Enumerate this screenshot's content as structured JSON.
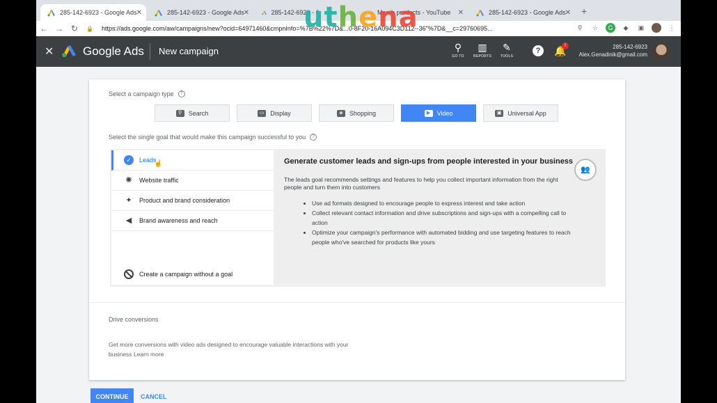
{
  "browser": {
    "tabs": [
      {
        "title": "285-142-6923 - Google Ads",
        "active": true
      },
      {
        "title": "285-142-6923 - Google Ads",
        "active": false
      },
      {
        "title": "285-142-6923 - Google Ads",
        "active": false
      },
      {
        "title": "Merch products - YouTube",
        "active": false
      },
      {
        "title": "285-142-6923 - Google Ads",
        "active": false
      }
    ],
    "url": "https://ads.google.com/aw/campaigns/new?ocid=64971460&cmpnInfo=%7B%22%7D&...0-8F20-16A094C3D112--36\"%7D&__c=29760695..."
  },
  "watermark": {
    "letters": [
      "u",
      "t",
      "h",
      "e",
      "n",
      "a"
    ]
  },
  "header": {
    "brand": "Google Ads",
    "page_title": "New campaign",
    "tools": [
      {
        "label": "GO TO",
        "icon": "search-icon"
      },
      {
        "label": "REPORTS",
        "icon": "reports-icon"
      },
      {
        "label": "TOOLS",
        "icon": "wrench-icon"
      }
    ],
    "help": "?",
    "bell_badge": "!",
    "account_id": "285-142-6923",
    "account_email": "Alex.Genadinik@gmail.com"
  },
  "campaign": {
    "type_label": "Select a campaign type",
    "types": [
      {
        "label": "Search",
        "selected": false
      },
      {
        "label": "Display",
        "selected": false
      },
      {
        "label": "Shopping",
        "selected": false
      },
      {
        "label": "Video",
        "selected": true
      },
      {
        "label": "Universal App",
        "selected": false
      }
    ],
    "goal_label": "Select the single goal that would make this campaign successful to you",
    "goals": [
      {
        "label": "Leads",
        "selected": true
      },
      {
        "label": "Website traffic",
        "selected": false
      },
      {
        "label": "Product and brand consideration",
        "selected": false
      },
      {
        "label": "Brand awareness and reach",
        "selected": false
      }
    ],
    "no_goal": "Create a campaign without a goal",
    "detail": {
      "title": "Generate customer leads and sign-ups from people interested in your business",
      "description": "The leads goal recommends settings and features to help you collect important information from the right people and turn them into customers",
      "bullets": [
        "Use ad formats designed to encourage people to express interest and take action",
        "Collect relevant contact information and drive subscriptions and sign-ups with a compelling call to action",
        "Optimize your campaign's performance with automated bidding and use targeting features to reach people who've searched for products like yours"
      ]
    },
    "drive": {
      "title": "Drive conversions",
      "description": "Get more conversions with video ads designed to encourage valuable interactions with your business",
      "link": "Learn more"
    }
  },
  "actions": {
    "continue": "CONTINUE",
    "cancel": "CANCEL"
  },
  "colors": {
    "accent": "#4285f4",
    "header_bg": "#3c4043"
  }
}
